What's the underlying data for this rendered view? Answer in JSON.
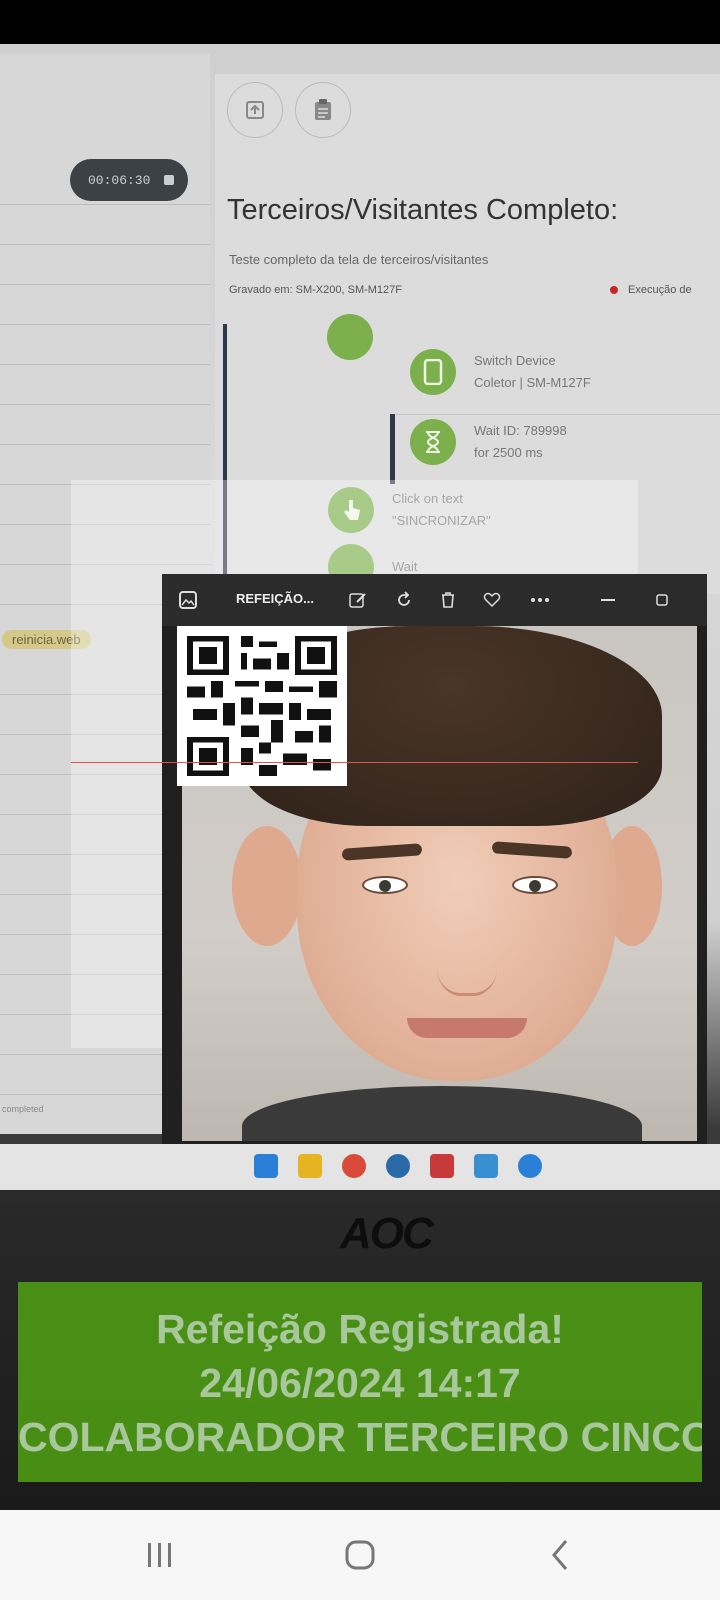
{
  "recorder": {
    "timer": "00:06:30",
    "tag": "reinicia.web",
    "footer_text": "completed"
  },
  "panel": {
    "title": "Terceiros/Visitantes Completo:",
    "description": "Teste completo da tela de terceiros/visitantes",
    "recorded_on": "Gravado em: SM-X200, SM-M127F",
    "execution_label": "Execução de",
    "steps": [
      {
        "line1": "Switch Device",
        "line2": "Coletor | SM-M127F",
        "icon": "phone-icon"
      },
      {
        "line1": "Wait ID: 789998",
        "line2": "for 2500 ms",
        "icon": "hourglass-icon"
      },
      {
        "line1": "Click on text",
        "line2": "\"SINCRONIZAR\"",
        "icon": "tap-icon"
      },
      {
        "line1": "Wait",
        "line2": "",
        "icon": "hourglass-icon"
      }
    ]
  },
  "viewer": {
    "title": "REFEIÇÃO..."
  },
  "monitor": {
    "brand": "AOC"
  },
  "banner": {
    "line1": "Refeição Registrada!",
    "line2": "24/06/2024 14:17",
    "line3": "COLABORADOR TERCEIRO CINCO",
    "color": "#4c9614"
  }
}
